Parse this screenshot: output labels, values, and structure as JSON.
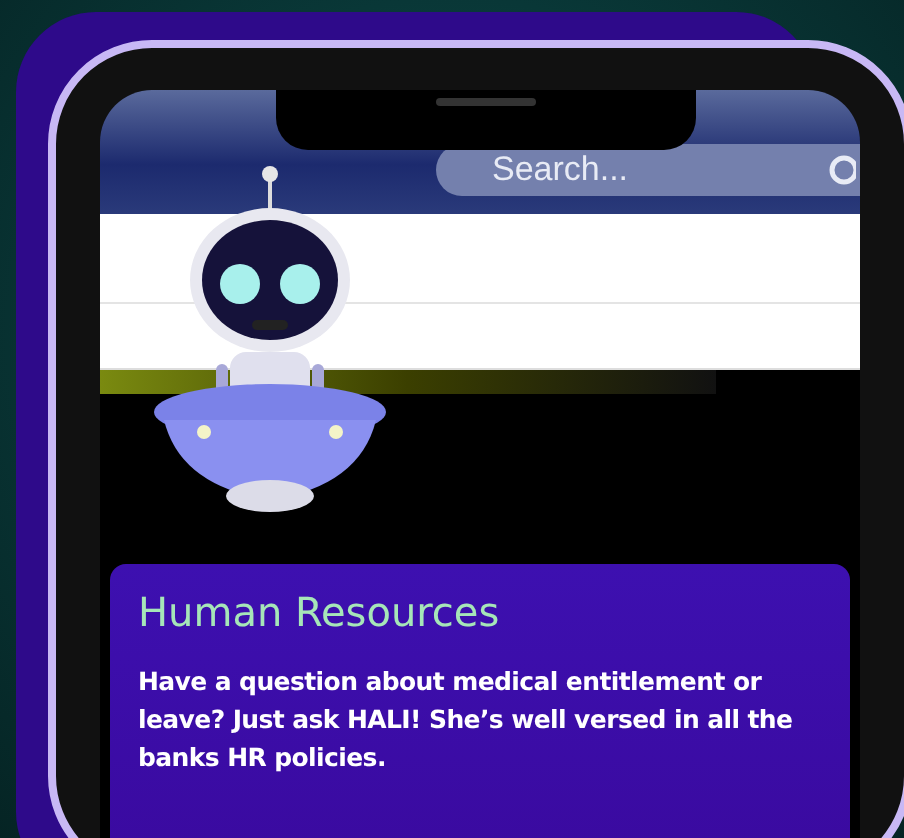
{
  "search": {
    "placeholder": "Search..."
  },
  "card": {
    "title": "Human Resources",
    "text": "Have a question about medical entitlement or leave? Just ask HALI! She’s well versed in all the banks HR policies."
  }
}
